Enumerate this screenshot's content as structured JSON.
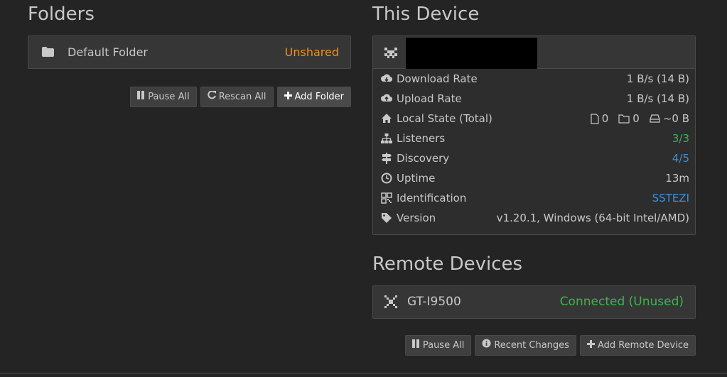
{
  "folders": {
    "title": "Folders",
    "items": [
      {
        "name": "Default Folder",
        "status": "Unshared"
      }
    ],
    "buttons": {
      "pause_all": "Pause All",
      "rescan_all": "Rescan All",
      "add_folder": "Add Folder"
    }
  },
  "this_device": {
    "title": "This Device",
    "rows": [
      {
        "icon": "cloud-download-icon",
        "label": "Download Rate",
        "value": "1 B/s (14 B)"
      },
      {
        "icon": "cloud-upload-icon",
        "label": "Upload Rate",
        "value": "1 B/s (14 B)"
      },
      {
        "icon": "home-icon",
        "label": "Local State (Total)",
        "files": "0",
        "folders": "0",
        "size": "~0 B"
      },
      {
        "icon": "sitemap-icon",
        "label": "Listeners",
        "value": "3/3"
      },
      {
        "icon": "signpost-icon",
        "label": "Discovery",
        "value": "4/5"
      },
      {
        "icon": "clock-icon",
        "label": "Uptime",
        "value": "13m"
      },
      {
        "icon": "qrcode-icon",
        "label": "Identification",
        "value": "SSTEZI"
      },
      {
        "icon": "tag-icon",
        "label": "Version",
        "value": "v1.20.1, Windows (64-bit Intel/AMD)"
      }
    ]
  },
  "remote_devices": {
    "title": "Remote Devices",
    "items": [
      {
        "name": "GT-I9500",
        "status": "Connected (Unused)"
      }
    ],
    "buttons": {
      "pause_all": "Pause All",
      "recent_changes": "Recent Changes",
      "add_remote": "Add Remote Device"
    }
  },
  "colors": {
    "background": "#242424",
    "unshared": "#e8931d",
    "connected": "#3cb44b",
    "link_blue": "#3f8fd8"
  }
}
